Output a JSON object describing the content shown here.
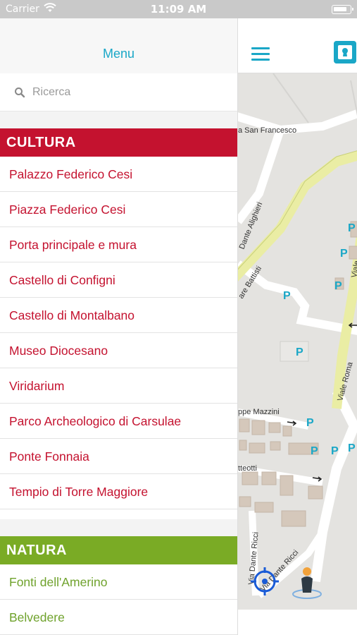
{
  "status_bar": {
    "carrier": "Carrier",
    "time": "11:09 AM"
  },
  "menu": {
    "title": "Menu",
    "search": {
      "placeholder": "Ricerca",
      "value": ""
    }
  },
  "sections": [
    {
      "title": "CULTURA",
      "color": "#c4122f",
      "items": [
        "Palazzo Federico Cesi",
        "Piazza Federico Cesi",
        "Porta principale e mura",
        "Castello di Configni",
        "Castello di Montalbano",
        "Museo Diocesano",
        "Viridarium",
        "Parco Archeologico di Carsulae",
        "Ponte Fonnaia",
        "Tempio di Torre Maggiore"
      ]
    },
    {
      "title": "NATURA",
      "color": "#7aab25",
      "items": [
        "Fonti dell'Amerino",
        "Belvedere"
      ]
    }
  ],
  "map": {
    "accent": "#1aa7c7",
    "street_labels": [
      "a San Francesco",
      "Dante Alighieri",
      "are Battisti",
      "Viale Roma",
      "Viale",
      "ppe Mazzini",
      "tteotti",
      "Via Dante Ricci",
      "Via Dante Ricci"
    ],
    "parking_label": "P"
  }
}
